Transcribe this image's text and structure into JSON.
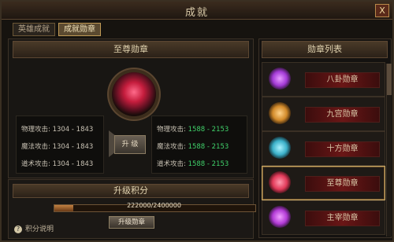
{
  "window": {
    "title": "成就",
    "close_label": "X"
  },
  "tabs": [
    {
      "label": "英雄成就"
    },
    {
      "label": "成就勋章"
    }
  ],
  "left": {
    "header": "至尊勋章",
    "current_stats": [
      {
        "label": "物理攻击:",
        "value": "1304 - 1843"
      },
      {
        "label": "魔法攻击:",
        "value": "1304 - 1843"
      },
      {
        "label": "道术攻击:",
        "value": "1304 - 1843"
      }
    ],
    "upgrade_button_label": "升 级",
    "next_stats": [
      {
        "label": "物理攻击:",
        "value": "1588 - 2153"
      },
      {
        "label": "魔法攻击:",
        "value": "1588 - 2153"
      },
      {
        "label": "道术攻击:",
        "value": "1588 - 2153"
      }
    ]
  },
  "points": {
    "header": "升级积分",
    "progress_text": "222000/2400000",
    "progress_fraction": 0.0925,
    "button_label": "升级勋章",
    "help_label": "积分说明"
  },
  "right": {
    "header": "勋章列表",
    "medals": [
      {
        "name": "八卦勋章",
        "icon": "octagram-medal-icon",
        "color": "#a33ad6"
      },
      {
        "name": "九宫勋章",
        "icon": "ninegrid-medal-icon",
        "color": "#d28a2a"
      },
      {
        "name": "十方勋章",
        "icon": "tendirection-medal-icon",
        "color": "#3bb0c9"
      },
      {
        "name": "至尊勋章",
        "icon": "supreme-medal-icon",
        "color": "#e23b5a",
        "selected": true
      },
      {
        "name": "主宰勋章",
        "icon": "sovereign-medal-icon",
        "color": "#b23bd6"
      }
    ]
  }
}
